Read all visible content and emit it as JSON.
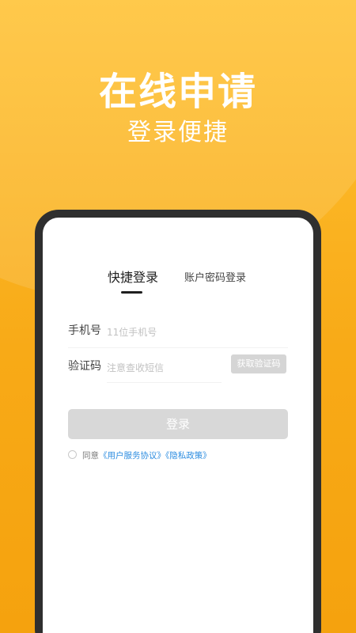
{
  "hero": {
    "title": "在线申请",
    "subtitle": "登录便捷"
  },
  "login": {
    "tabs": {
      "active": "快捷登录",
      "inactive": "账户密码登录"
    },
    "phone": {
      "label": "手机号",
      "placeholder": "11位手机号"
    },
    "code": {
      "label": "验证码",
      "placeholder": "注意查收短信",
      "button": "获取验证码"
    },
    "submit": "登录",
    "agreement": {
      "prefix": "同意",
      "user_agreement": "《用户服务协议》",
      "privacy_policy": "《隐私政策》"
    }
  },
  "colors": {
    "background_top": "#ffc233",
    "background_bottom": "#f5a20e",
    "device_frame": "#2f2f2f",
    "card": "#ffffff",
    "disabled_button": "#d8d8d8",
    "link": "#2d8de0"
  }
}
